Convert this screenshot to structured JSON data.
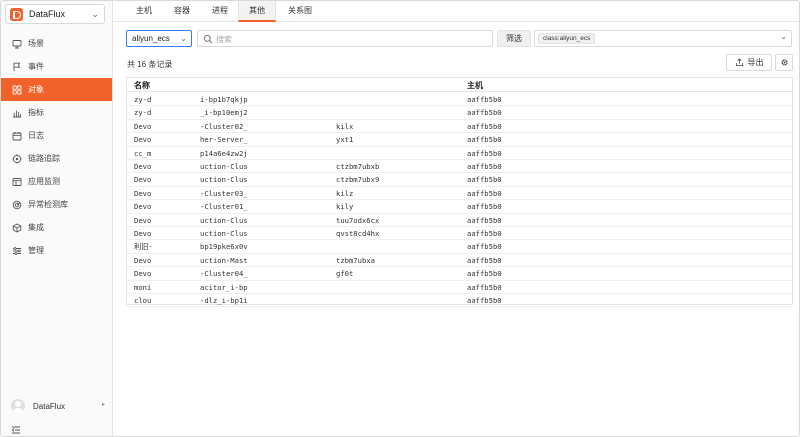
{
  "brand": {
    "name": "DataFlux",
    "chevron": "⌄"
  },
  "nav": [
    {
      "label": "场景",
      "icon": "monitor-icon"
    },
    {
      "label": "事件",
      "icon": "flag-icon"
    },
    {
      "label": "对象",
      "icon": "grid-icon"
    },
    {
      "label": "指标",
      "icon": "bar-chart-icon"
    },
    {
      "label": "日志",
      "icon": "calendar-icon"
    },
    {
      "label": "链路追踪",
      "icon": "target-icon"
    },
    {
      "label": "应用监测",
      "icon": "app-window-icon"
    },
    {
      "label": "异常检测库",
      "icon": "radar-icon"
    },
    {
      "label": "集成",
      "icon": "cube-icon"
    },
    {
      "label": "管理",
      "icon": "sliders-icon"
    }
  ],
  "active_nav": "对象",
  "user": {
    "name": "DataFlux",
    "caret": "▸"
  },
  "tabs": [
    "主机",
    "容器",
    "进程",
    "其他",
    "关系图"
  ],
  "active_tab": "其他",
  "filter": {
    "select_value": "aliyun_ecs",
    "search_placeholder": "搜索",
    "filter_label": "筛选",
    "tag": "class:aliyun_ecs"
  },
  "summary": "共 16 条记录",
  "toolbar": {
    "export_label": "导出"
  },
  "colors": {
    "accent": "#f0622a",
    "focus": "#3b7df0"
  },
  "table": {
    "headers": {
      "name": "名称",
      "host": "主机"
    },
    "rows": [
      [
        "zy-d",
        "i-bp1b7qkjp",
        "",
        "aaffb5b0"
      ],
      [
        "zy-d",
        "_i-bp10emj2",
        "",
        "aaffb5b0"
      ],
      [
        "Devo",
        "-Cluster02_",
        "kilx",
        "aaffb5b0"
      ],
      [
        "Devo",
        "her-Server_",
        "yxt1",
        "aaffb5b0"
      ],
      [
        "cc_m",
        "p14a6e4zw2j",
        "",
        "aaffb5b0"
      ],
      [
        "Devo",
        "uction-Clus",
        "ctzbm7ubxb",
        "aaffb5b0"
      ],
      [
        "Devo",
        "uction-Clus",
        "ctzbm7ubx9",
        "aaffb5b0"
      ],
      [
        "Devo",
        "-Cluster03_",
        "kilz",
        "aaffb5b0"
      ],
      [
        "Devo",
        "-Cluster01_",
        "kily",
        "aaffb5b0"
      ],
      [
        "Devo",
        "uction-Clus",
        "tuu7odx6cx",
        "aaffb5b0"
      ],
      [
        "Devo",
        "uction-Clus",
        "qvst8cd4hx",
        "aaffb5b0"
      ],
      [
        "利旧-",
        "bp19pke6x0v",
        "",
        "aaffb5b0"
      ],
      [
        "Devo",
        "uction-Mast",
        "tzbm7ubxa",
        "aaffb5b0"
      ],
      [
        "Devo",
        "-Cluster04_",
        "gf0t",
        "aaffb5b0"
      ],
      [
        "moni",
        "acitor_i-bp",
        "",
        "aaffb5b0"
      ],
      [
        "clou",
        "-dlz_i-bp1i",
        "",
        "aaffb5b0"
      ]
    ]
  }
}
